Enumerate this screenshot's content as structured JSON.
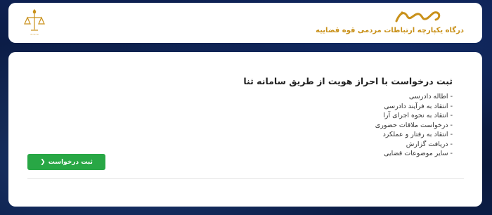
{
  "header": {
    "brand_title": "درگاه یکپارچه ارتباطات مردمی قوه قضاییه",
    "emblem_icon": "judiciary-scales-emblem",
    "logo_icon": "samad-logo",
    "brand_color": "#c9911a"
  },
  "main": {
    "title": "ثبت درخواست با احراز هویت از طریق سامانه ثنا",
    "items": [
      {
        "label": "- اطاله دادرسی"
      },
      {
        "label": "- انتقاد به فرآیند دادرسی"
      },
      {
        "label": "- انتقاد به نحوه اجرای آرا"
      },
      {
        "label": "- درخواست ملاقات حضوری"
      },
      {
        "label": "- انتقاد به رفتار و عملکرد"
      },
      {
        "label": "- دریافت گزارش"
      },
      {
        "label": "- سایر موضوعات قضایی"
      }
    ],
    "submit_button": {
      "label": "ثبت درخواست",
      "icon": "chevron-left-icon",
      "color": "#28a745"
    }
  }
}
